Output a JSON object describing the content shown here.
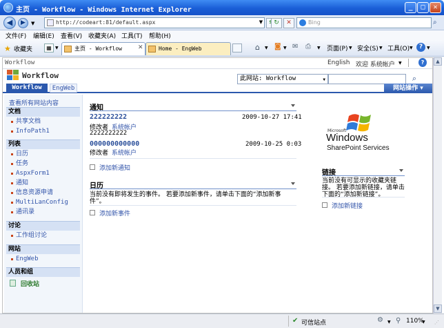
{
  "window": {
    "title": "主页 - Workflow - Windows Internet Explorer"
  },
  "address": {
    "url": "http://codeart:81/default.aspx",
    "search_placeholder": "Bing"
  },
  "menu": [
    "文件(F)",
    "编辑(E)",
    "查看(V)",
    "收藏夹(A)",
    "工具(T)",
    "帮助(H)"
  ],
  "favbar": {
    "favorites_label": "收藏夹",
    "tabs": [
      "主页 - Workflow",
      "Home - EngWeb"
    ],
    "tools": [
      "页面(P)",
      "安全(S)",
      "工具(O)"
    ]
  },
  "sp": {
    "breadcrumb": "Workflow",
    "language": "English",
    "welcome": "欢迎 系统帐户",
    "site_title": "Workflow",
    "scope_value": "此网站: Workflow",
    "top_tabs": [
      "Workflow",
      "EngWeb"
    ],
    "site_actions": "网站操作",
    "view_all": "查看所有网站内容",
    "quicklaunch": [
      {
        "heading": "文档",
        "items": [
          "共享文档",
          "InfoPath1"
        ]
      },
      {
        "heading": "列表",
        "items": [
          "日历",
          "任务",
          "AspxForm1",
          "通知",
          "信息资源申请",
          "MultiLanConfig",
          "通讯录"
        ]
      },
      {
        "heading": "讨论",
        "items": [
          "工作组讨论"
        ]
      },
      {
        "heading": "网站",
        "items": [
          "EngWeb"
        ]
      },
      {
        "heading": "人员和组",
        "items": []
      }
    ],
    "recycle_bin": "回收站",
    "announcements": {
      "title": "通知",
      "items": [
        {
          "title": "222222222",
          "date": "2009-10-27 17:41",
          "modified_by_label": "修改者",
          "modified_by": "系统帐户",
          "body": "2222222222"
        },
        {
          "title": "000000000000",
          "date": "2009-10-25 0:03",
          "modified_by_label": "修改者",
          "modified_by": "系统帐户",
          "body": ""
        }
      ],
      "add_link": "添加新通知"
    },
    "calendar": {
      "title": "日历",
      "empty_text": "当前没有即将发生的事件。 若要添加新事件，请单击下面的“添加新事件”。",
      "add_link": "添加新事件"
    },
    "logo": {
      "microsoft": "Microsoft",
      "windows": "Windows",
      "product": "SharePoint Services"
    },
    "links": {
      "title": "链接",
      "empty_text": "当前没有可显示的收藏夹链接。 若要添加新链接，请单击下面的“添加新链接”。",
      "add_link": "添加新链接"
    }
  },
  "status": {
    "zone": "可信站点",
    "zoom": "110%"
  },
  "colors": {
    "accent": "#2b58ad",
    "link": "#3355aa",
    "ql_heading_bg": "#d5e1f4"
  }
}
